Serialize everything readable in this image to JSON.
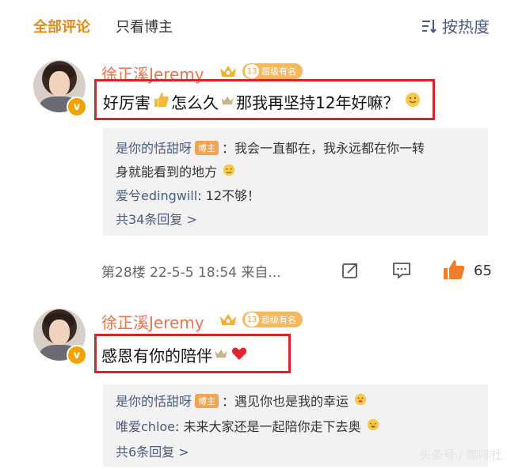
{
  "tabs": {
    "all": "全部评论",
    "blogger_only": "只看博主"
  },
  "sort": {
    "label": "按热度"
  },
  "comments": [
    {
      "username": "徐正溪Jeremy",
      "medal_level": "13",
      "medal_text": "超级有名",
      "text_parts": [
        "好厉害",
        "怎么久",
        "那我再坚持12年好嘛？"
      ],
      "replies": [
        {
          "name": "是你的恬甜呀",
          "tag": "博主",
          "text_1": "：我会一直都在，我永远都在你一转",
          "text_2": "身就能看到的地方"
        },
        {
          "name": "爱兮edingwill",
          "text": ": 12不够！"
        }
      ],
      "more_replies": "共34条回复 >",
      "meta": "第28楼  22-5-5 18:54  来自...",
      "like_count": "65"
    },
    {
      "username": "徐正溪Jeremy",
      "medal_level": "13",
      "medal_text": "超级有名",
      "text_parts": [
        "感恩有你的陪伴"
      ],
      "replies": [
        {
          "name": "是你的恬甜呀",
          "tag": "博主",
          "text": "：遇见你也是我的幸运"
        },
        {
          "name": "唯爱chloe",
          "text": ": 未来大家还是一起陪你走下去奥"
        }
      ],
      "more_replies": "共6条回复 >"
    }
  ],
  "watermark": "头条号 / 咖啡社",
  "colors": {
    "accent": "#e58a14",
    "username": "#eb7350",
    "highlight_box": "#d9232a",
    "link": "#4a5a80"
  }
}
